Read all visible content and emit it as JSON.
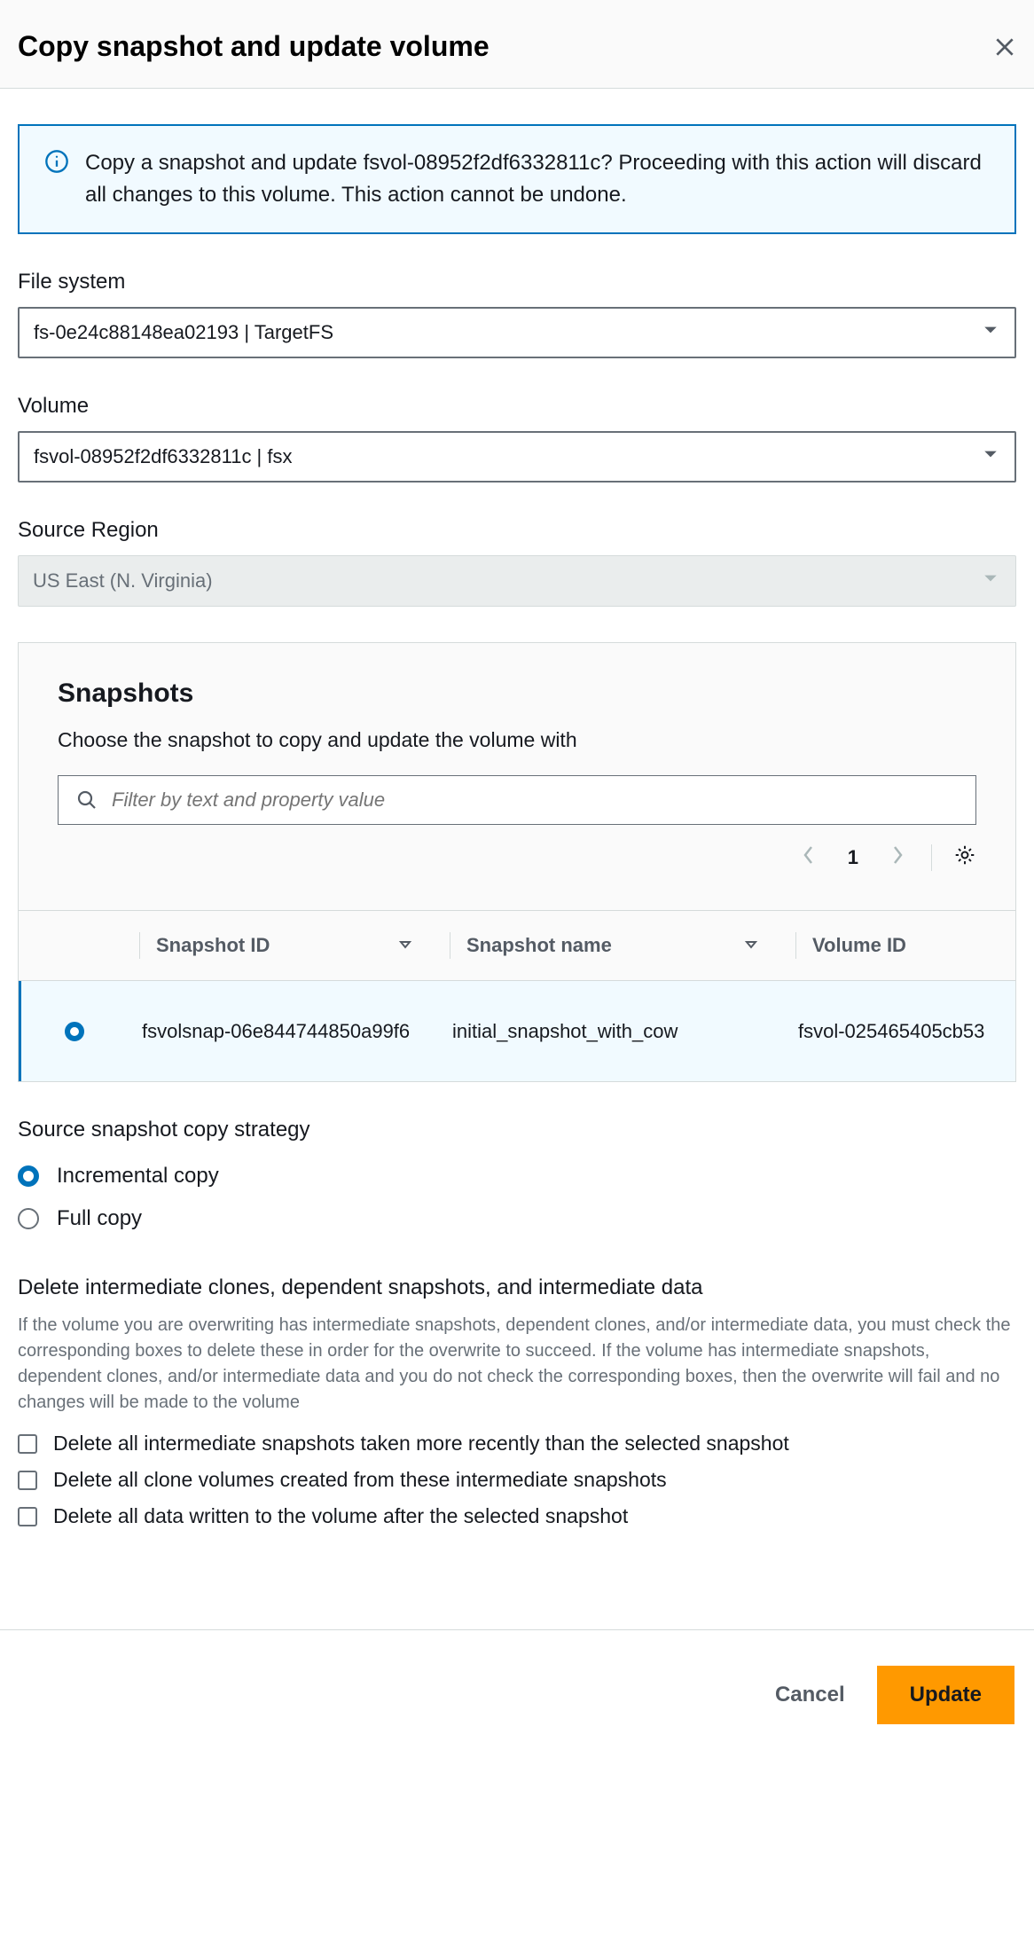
{
  "header": {
    "title": "Copy snapshot and update volume"
  },
  "alert": {
    "text": "Copy a snapshot and update fsvol-08952f2df6332811c? Proceeding with this action will discard all changes to this volume. This action cannot be undone."
  },
  "fileSystem": {
    "label": "File system",
    "value": "fs-0e24c88148ea02193 | TargetFS"
  },
  "volume": {
    "label": "Volume",
    "value": "fsvol-08952f2df6332811c | fsx"
  },
  "sourceRegion": {
    "label": "Source Region",
    "value": "US East (N. Virginia)"
  },
  "snapshots": {
    "title": "Snapshots",
    "subtitle": "Choose the snapshot to copy and update the volume with",
    "filterPlaceholder": "Filter by text and property value",
    "page": "1",
    "columns": {
      "id": "Snapshot ID",
      "name": "Snapshot name",
      "vol": "Volume ID"
    },
    "row": {
      "id": "fsvolsnap-06e844744850a99f6",
      "name": "initial_snapshot_with_cow",
      "vol": "fsvol-025465405cb53"
    }
  },
  "strategy": {
    "label": "Source snapshot copy strategy",
    "optIncremental": "Incremental copy",
    "optFull": "Full copy"
  },
  "deleteSection": {
    "title": "Delete intermediate clones, dependent snapshots, and intermediate data",
    "help": "If the volume you are overwriting has intermediate snapshots, dependent clones, and/or intermediate data, you must check the corresponding boxes to delete these in order for the overwrite to succeed. If the volume has intermediate snapshots, dependent clones, and/or intermediate data and you do not check the corresponding boxes, then the overwrite will fail and no changes will be made to the volume",
    "opt1": "Delete all intermediate snapshots taken more recently than the selected snapshot",
    "opt2": "Delete all clone volumes created from these intermediate snapshots",
    "opt3": "Delete all data written to the volume after the selected snapshot"
  },
  "footer": {
    "cancel": "Cancel",
    "update": "Update"
  }
}
